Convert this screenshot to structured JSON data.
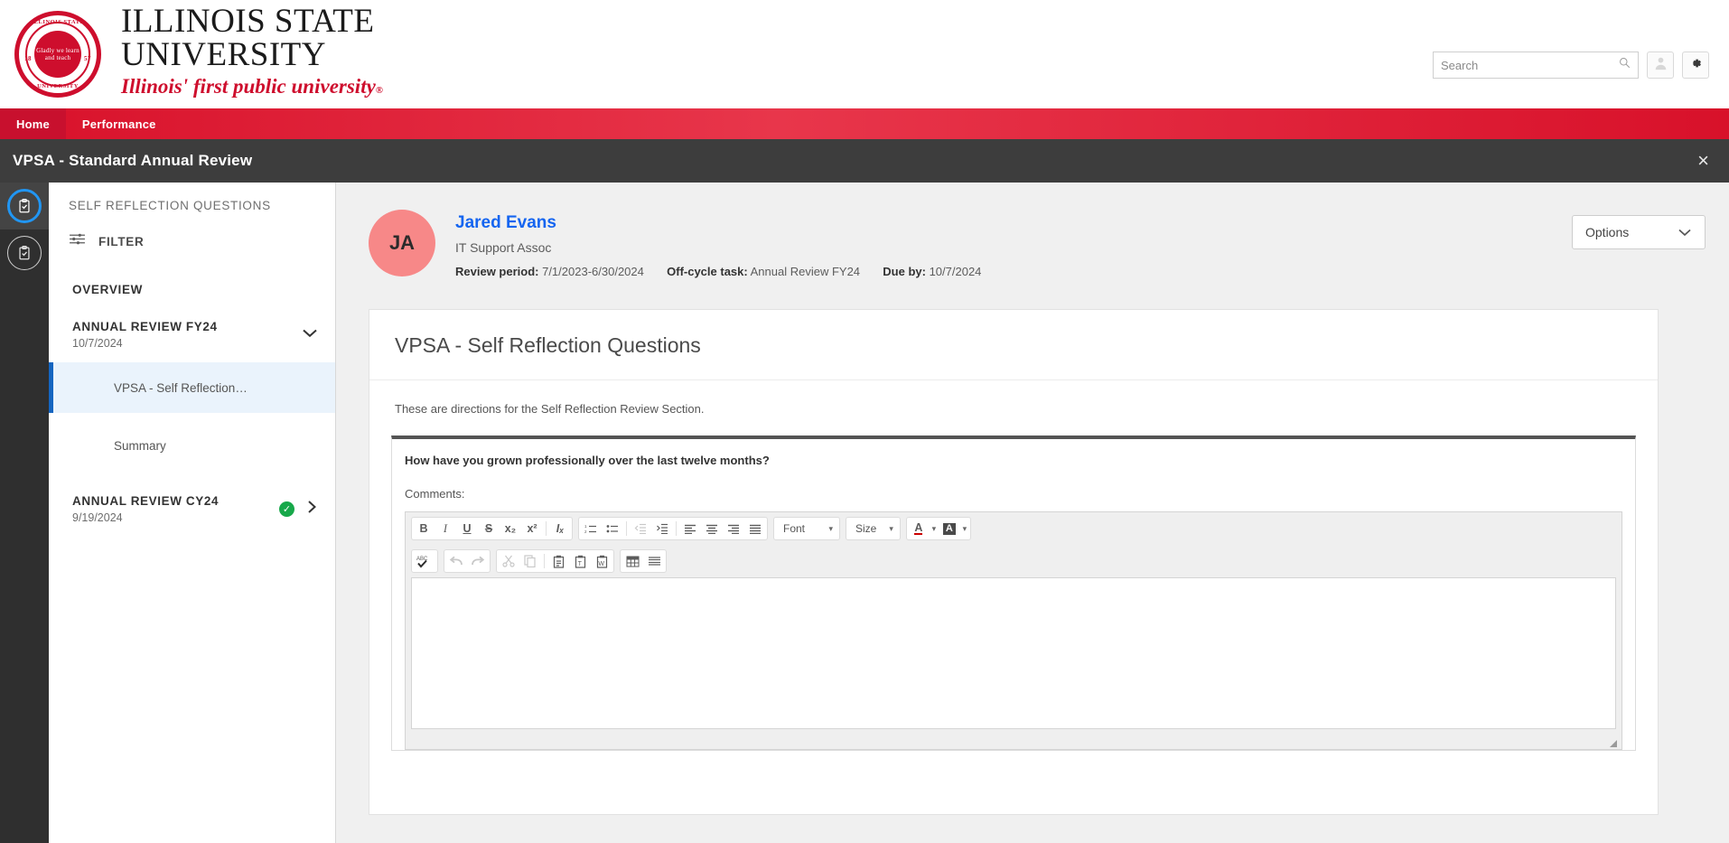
{
  "brand": {
    "seal": {
      "top_text": "ILLINOIS STATE",
      "bottom_text": "UNIVERSITY",
      "left_year": "18",
      "right_year": "57",
      "motto": "Gladly we learn and teach"
    },
    "line1": "ILLINOIS STATE",
    "line2": "UNIVERSITY",
    "tagline": "Illinois' first public university",
    "tagline_mark": "®"
  },
  "search": {
    "placeholder": "Search",
    "value": "",
    "icon": "search-icon"
  },
  "header_buttons": {
    "avatar_icon": "user-avatar-icon",
    "settings_icon": "gear-icon"
  },
  "nav": {
    "items": [
      {
        "label": "Home",
        "active": true
      },
      {
        "label": "Performance",
        "active": false
      }
    ],
    "brand_red": "#c8102e"
  },
  "title_bar": {
    "title": "VPSA - Standard Annual Review",
    "close_icon": "close-icon",
    "close_label": "×",
    "background": "#3d3d3d"
  },
  "icon_rail": {
    "items": [
      {
        "name": "review-tasks-icon",
        "active": true,
        "ring_color": "#2196f3"
      },
      {
        "name": "completed-tasks-icon",
        "active": false,
        "ring_color": "#cfcfcf"
      }
    ]
  },
  "left_panel": {
    "heading": "SELF REFLECTION QUESTIONS",
    "filter_label": "FILTER",
    "filter_icon": "filter-sliders-icon",
    "overview_label": "OVERVIEW",
    "groups": [
      {
        "title": "ANNUAL REVIEW FY24",
        "date": "10/7/2024",
        "expanded": true,
        "chevron": "chevron-down-icon",
        "chevron_glyph": "⌄",
        "complete": false,
        "children": [
          {
            "label": "VPSA - Self Reflection…",
            "selected": true
          },
          {
            "label": "Summary",
            "selected": false
          }
        ]
      },
      {
        "title": "ANNUAL REVIEW CY24",
        "date": "9/19/2024",
        "expanded": false,
        "chevron": "chevron-right-icon",
        "chevron_glyph": "›",
        "complete": true,
        "complete_badge": "✓",
        "complete_color": "#17a84a",
        "children": []
      }
    ],
    "selected_accent": "#1565c0"
  },
  "employee": {
    "avatar_initials": "JA",
    "avatar_color": "#f78888",
    "name": "Jared Evans",
    "job_title": "IT Support Assoc",
    "meta": [
      {
        "label": "Review period:",
        "value": "7/1/2023-6/30/2024"
      },
      {
        "label": "Off-cycle task:",
        "value": "Annual Review FY24"
      },
      {
        "label": "Due by:",
        "value": "10/7/2024"
      }
    ],
    "name_color": "#1565f0"
  },
  "options": {
    "label": "Options",
    "chevron_icon": "chevron-down-icon",
    "chevron_glyph": "⌄"
  },
  "card": {
    "title": "VPSA - Self Reflection Questions",
    "directions": "These are directions for the Self Reflection Review Section.",
    "question": "How have you grown professionally over the last twelve months?",
    "comments_label": "Comments:"
  },
  "editor": {
    "value": "",
    "row1": {
      "format_group": [
        {
          "name": "bold-icon",
          "glyph": "B",
          "style": "bold",
          "dim": false
        },
        {
          "name": "italic-icon",
          "glyph": "I",
          "style": "italic",
          "dim": false
        },
        {
          "name": "underline-icon",
          "glyph": "U",
          "style": "underline",
          "dim": false
        },
        {
          "name": "strikethrough-icon",
          "glyph": "S",
          "style": "strike",
          "dim": false
        },
        {
          "name": "subscript-icon",
          "glyph": "x₂",
          "style": "",
          "dim": false
        },
        {
          "name": "superscript-icon",
          "glyph": "x²",
          "style": "",
          "dim": false
        },
        {
          "name": "remove-format-icon",
          "glyph": "Iₓ",
          "style": "italic",
          "dim": false
        }
      ],
      "list_group": [
        {
          "name": "numbered-list-icon",
          "dim": false
        },
        {
          "name": "bulleted-list-icon",
          "dim": false
        },
        {
          "name": "outdent-icon",
          "dim": true
        },
        {
          "name": "indent-icon",
          "dim": false
        },
        {
          "name": "align-left-icon",
          "dim": false
        },
        {
          "name": "align-center-icon",
          "dim": false
        },
        {
          "name": "align-right-icon",
          "dim": false
        },
        {
          "name": "align-justify-icon",
          "dim": false
        }
      ],
      "font_select": {
        "label": "Font",
        "chevron_glyph": "▾"
      },
      "size_select": {
        "label": "Size",
        "chevron_glyph": "▾"
      },
      "text_color": {
        "name": "text-color-icon",
        "glyph": "A",
        "chevron_glyph": "▾"
      },
      "bg_color": {
        "name": "background-color-icon",
        "glyph": "A",
        "chevron_glyph": "▾"
      }
    },
    "row2": {
      "spell_check": {
        "name": "spell-check-icon",
        "glyph": "ABC"
      },
      "history_group": [
        {
          "name": "undo-icon",
          "glyph": "↶",
          "dim": true
        },
        {
          "name": "redo-icon",
          "glyph": "↷",
          "dim": true
        }
      ],
      "clipboard_group": [
        {
          "name": "cut-icon",
          "glyph": "✂",
          "dim": true
        },
        {
          "name": "copy-icon",
          "glyph": "⧉",
          "dim": true
        },
        {
          "name": "paste-icon",
          "glyph": "Ὄb",
          "dim": false
        },
        {
          "name": "paste-as-text-icon",
          "glyph": "T",
          "dim": false
        },
        {
          "name": "paste-from-word-icon",
          "glyph": "W",
          "dim": false
        }
      ],
      "insert_group": [
        {
          "name": "table-icon",
          "dim": false
        },
        {
          "name": "horizontal-rule-icon",
          "dim": false
        }
      ]
    },
    "resize_handle": "resize-grip-handle"
  }
}
